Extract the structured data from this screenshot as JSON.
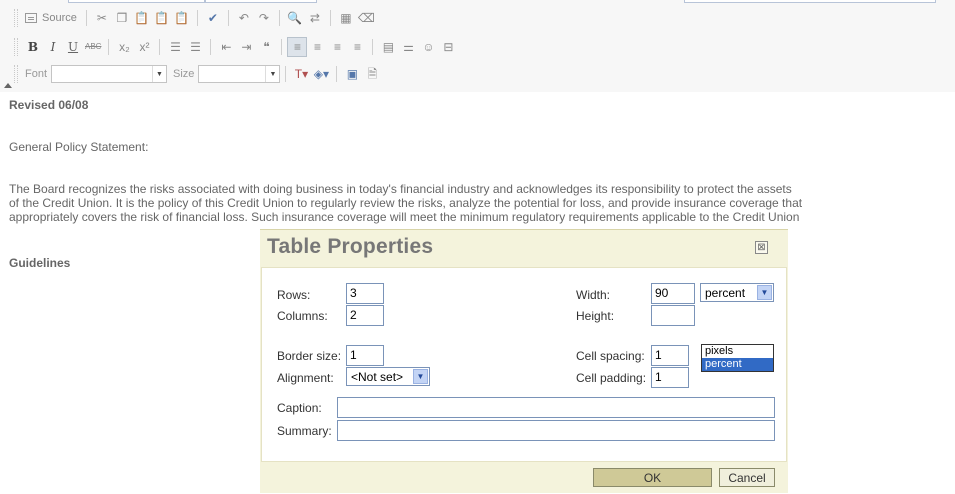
{
  "toolbar": {
    "source_label": "Source",
    "font_label": "Font",
    "size_label": "Size",
    "icons": [
      "source-icon",
      "cut-icon",
      "copy-icon",
      "paste-icon",
      "paste-text-icon",
      "paste-word-icon",
      "spellcheck-icon",
      "undo-icon",
      "redo-icon",
      "find-icon",
      "replace-icon",
      "select-all-icon",
      "remove-format-icon",
      "bold-icon",
      "italic-icon",
      "underline-icon",
      "strike-icon",
      "subscript-icon",
      "superscript-icon",
      "ordered-list-icon",
      "bulleted-list-icon",
      "outdent-icon",
      "indent-icon",
      "blockquote-icon",
      "align-left-icon",
      "align-center-icon",
      "align-right-icon",
      "justify-icon",
      "table-icon",
      "horizontal-rule-icon",
      "smiley-icon",
      "special-char-icon",
      "text-color-icon",
      "background-color-icon",
      "maximize-icon",
      "preview-icon"
    ]
  },
  "document": {
    "revised": "Revised 06/08",
    "general_policy": "General Policy Statement:",
    "paragraph_lines": [
      "The Board recognizes the risks associated with doing business in today's financial industry and acknowledges its responsibility to protect the assets",
      "of the Credit Union. It is the policy of this Credit Union to regularly review the risks, analyze the potential for loss, and provide insurance coverage that",
      "appropriately covers the risk of financial loss. Such insurance coverage will meet the minimum regulatory requirements applicable to the Credit Union"
    ],
    "guidelines": "Guidelines"
  },
  "dialog": {
    "title": "Table Properties",
    "close": "⊠",
    "rows_label": "Rows:",
    "rows_value": "3",
    "columns_label": "Columns:",
    "columns_value": "2",
    "border_label": "Border size:",
    "border_value": "1",
    "alignment_label": "Alignment:",
    "alignment_value": "<Not set>",
    "width_label": "Width:",
    "width_value": "90",
    "width_unit": "percent",
    "width_unit_options": [
      "pixels",
      "percent"
    ],
    "height_label": "Height:",
    "height_value": "",
    "cell_spacing_label": "Cell spacing:",
    "cell_spacing_value": "1",
    "cell_padding_label": "Cell padding:",
    "cell_padding_value": "1",
    "caption_label": "Caption:",
    "caption_value": "",
    "summary_label": "Summary:",
    "summary_value": "",
    "ok_label": "OK",
    "cancel_label": "Cancel"
  },
  "colors": {
    "dialog_bg": "#f4f3dc",
    "ok_button": "#cfc997",
    "selection": "#316ac5",
    "input_border": "#7a93b8"
  }
}
